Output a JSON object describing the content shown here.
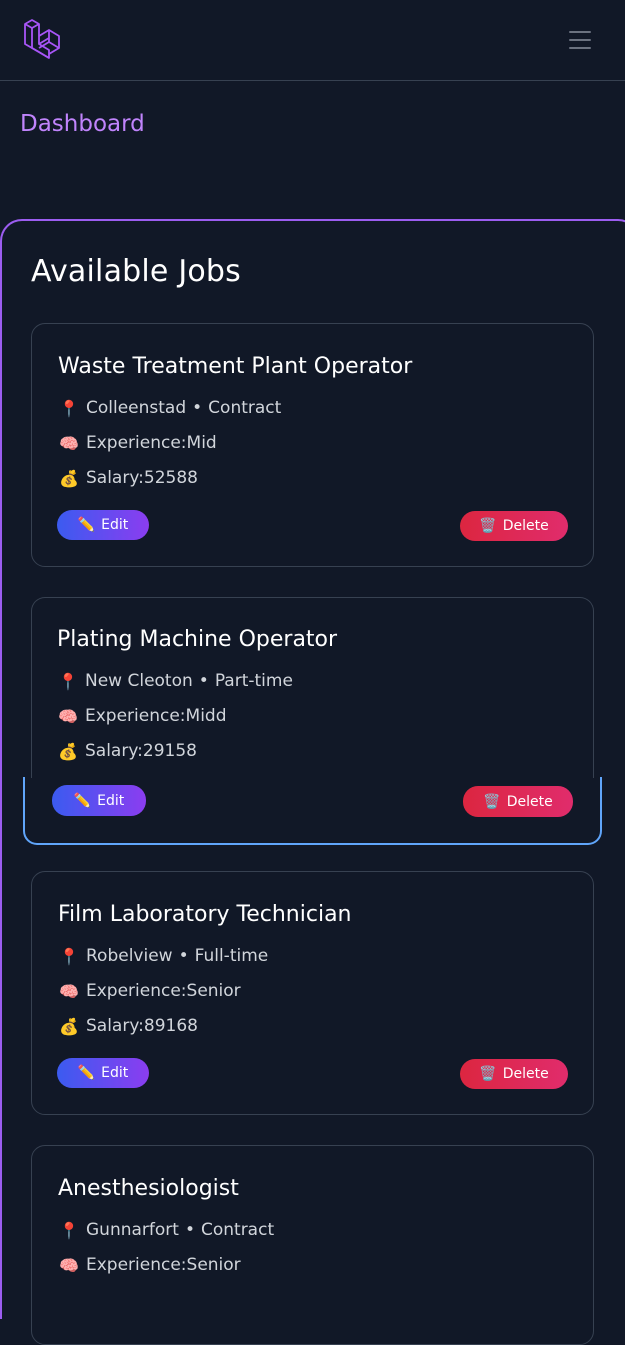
{
  "nav": {
    "dashboard_label": "Dashboard"
  },
  "section_title": "Available Jobs",
  "icons": {
    "location": "📍",
    "experience": "🧠",
    "salary": "💰",
    "edit": "✏️",
    "delete": "🗑️"
  },
  "labels": {
    "experience_prefix": "Experience: ",
    "salary_prefix": "Salary: ",
    "edit": "Edit",
    "delete": "Delete",
    "separator": "•"
  },
  "jobs": [
    {
      "title": "Waste Treatment Plant Operator",
      "location": "Colleenstad",
      "type": "Contract",
      "experience": "Mid",
      "salary": "52588"
    },
    {
      "title": "Plating Machine Operator",
      "location": "New Cleoton",
      "type": "Part-time",
      "experience": "Midd",
      "salary": "29158"
    },
    {
      "title": "Film Laboratory Technician",
      "location": "Robelview",
      "type": "Full-time",
      "experience": "Senior",
      "salary": "89168"
    },
    {
      "title": "Anesthesiologist",
      "location": "Gunnarfort",
      "type": "Contract",
      "experience": "Senior",
      "salary": ""
    }
  ],
  "colors": {
    "background": "#111827",
    "accent_purple": "#c084fc",
    "panel_border": "#9c5df0",
    "hover_border": "#60a5fa"
  }
}
